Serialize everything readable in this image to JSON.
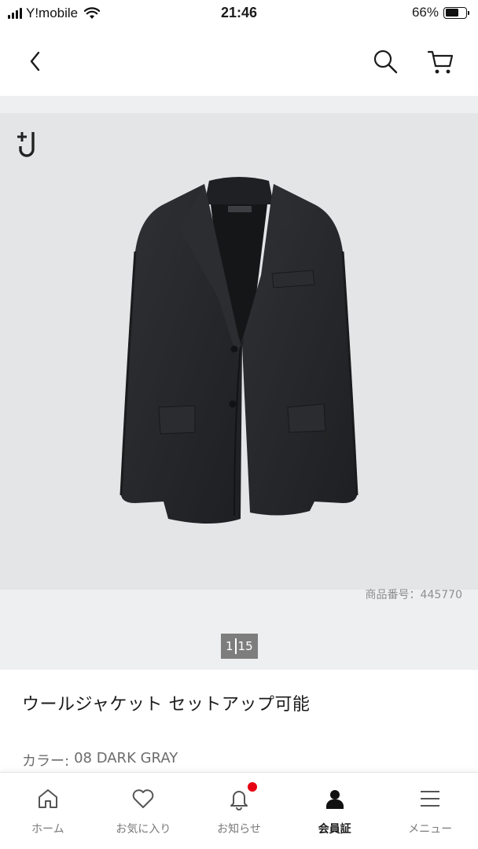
{
  "status_bar": {
    "carrier": "Y!mobile",
    "time": "21:46",
    "battery_percent": "66%",
    "battery_level": 0.66
  },
  "header": {
    "back_icon": "chevron-left-icon",
    "search_icon": "search-icon",
    "cart_icon": "cart-icon"
  },
  "gallery": {
    "brand_logo_icon": "plus-j-logo",
    "product_number": "商品番号：445770",
    "pager": {
      "current": "1",
      "total": "15"
    }
  },
  "product": {
    "title": "ウールジャケット セットアップ可能",
    "color_label": "カラー:",
    "color_value": "08 DARK GRAY"
  },
  "bottom_nav": {
    "items": [
      {
        "label": "ホーム",
        "icon": "home-icon",
        "active": false
      },
      {
        "label": "お気に入り",
        "icon": "heart-icon",
        "active": false
      },
      {
        "label": "お知らせ",
        "icon": "bell-icon",
        "active": false,
        "badge": true
      },
      {
        "label": "会員証",
        "icon": "member-card-icon",
        "active": true
      },
      {
        "label": "メニュー",
        "icon": "menu-icon",
        "active": false
      }
    ]
  },
  "colors": {
    "accent_red": "#e60012",
    "gallery_bg": "#e4e5e7",
    "pager_bg": "#7d7d7d"
  }
}
